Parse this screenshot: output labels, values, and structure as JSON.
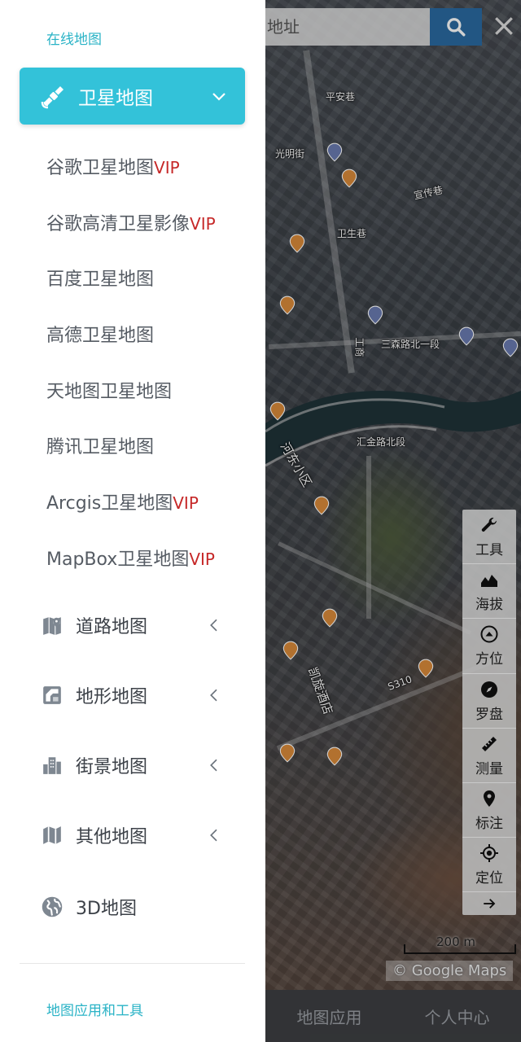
{
  "search": {
    "placeholder": "地址"
  },
  "map": {
    "labels": [
      "平安巷",
      "光明街",
      "卫生巷",
      "宣传巷",
      "三森路北一段",
      "汇金路北段",
      "S310",
      "工商",
      "河东小区",
      "凯旋酒店"
    ],
    "attribution": "© Google Maps",
    "scale_label": "200 m"
  },
  "toolbar": {
    "tools": [
      {
        "label": "工具",
        "icon": "wrench-icon"
      },
      {
        "label": "海拔",
        "icon": "elevation-icon"
      },
      {
        "label": "方位",
        "icon": "orientation-icon"
      },
      {
        "label": "罗盘",
        "icon": "compass-icon"
      },
      {
        "label": "测量",
        "icon": "ruler-icon"
      },
      {
        "label": "标注",
        "icon": "location-pin-icon"
      },
      {
        "label": "定位",
        "icon": "crosshair-icon"
      }
    ],
    "collapse_icon": "arrow-right-icon"
  },
  "tabbar": {
    "tabs": [
      "地图应用",
      "个人中心"
    ]
  },
  "drawer": {
    "section1_title": "在线地图",
    "active": {
      "label": "卫星地图",
      "icon": "satellite-icon"
    },
    "satellite_items": [
      {
        "label": "谷歌卫星地图",
        "vip": "VIP"
      },
      {
        "label": "谷歌高清卫星影像",
        "vip": "VIP"
      },
      {
        "label": "百度卫星地图",
        "vip": ""
      },
      {
        "label": "高德卫星地图",
        "vip": ""
      },
      {
        "label": "天地图卫星地图",
        "vip": ""
      },
      {
        "label": "腾讯卫星地图",
        "vip": ""
      },
      {
        "label": "Arcgis卫星地图",
        "vip": "VIP"
      },
      {
        "label": "MapBox卫星地图",
        "vip": "VIP"
      }
    ],
    "categories": [
      {
        "label": "道路地图",
        "icon": "road-map-icon"
      },
      {
        "label": "地形地图",
        "icon": "terrain-map-icon"
      },
      {
        "label": "街景地图",
        "icon": "city-buildings-icon"
      },
      {
        "label": "其他地图",
        "icon": "folded-map-icon"
      },
      {
        "label": "3D地图",
        "icon": "globe-icon"
      }
    ],
    "section2_title": "地图应用和工具"
  },
  "colors": {
    "accent": "#33c2d9",
    "vip": "#c62828",
    "search_button": "#2a6aa0"
  }
}
